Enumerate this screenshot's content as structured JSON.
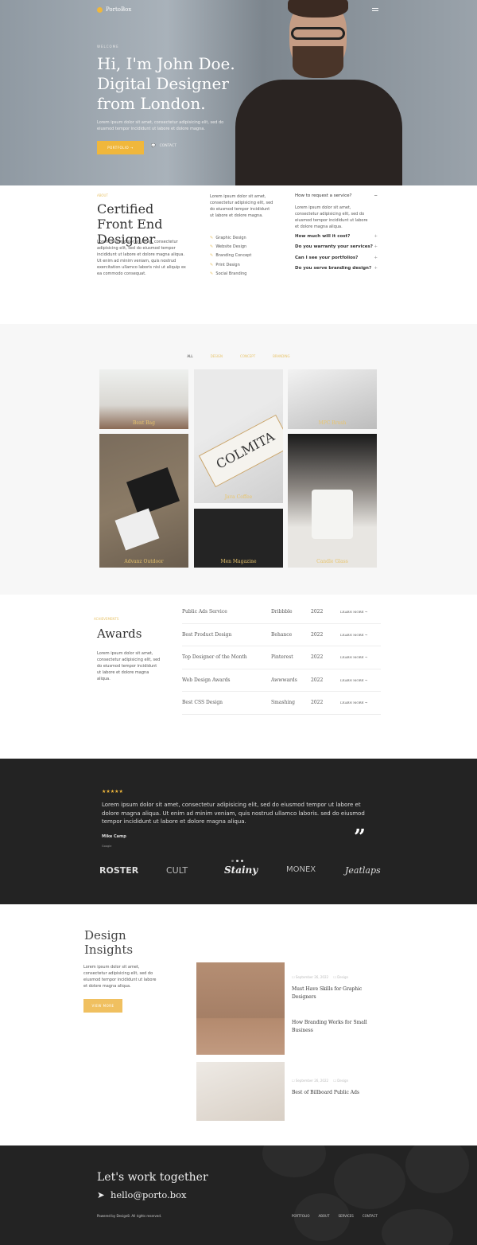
{
  "header": {
    "logo": "PortoBox",
    "menu_icon": "hamburger-icon"
  },
  "hero": {
    "eyebrow": "WELCOME",
    "title": "Hi, I'm John Doe. Digital Designer from London.",
    "text": "Lorem ipsum dolor sit amet, consectetur adipisicing elit, sed do eiusmod tempor incididunt ut labore et dolore magna.",
    "portfolio_btn": "PORTFOLIO →",
    "contact_btn": "CONTACT"
  },
  "about": {
    "eyebrow": "ABOUT",
    "title": "Certified Front End Designer",
    "text": "Lorem ipsum dolor sit amet, consectetur adipisicing elit, sed do eiusmod tempor incididunt ut labore et dolore magna aliqua. Ut enim ad minim veniam, quis nostrud exercitation ullamco laboris nisi ut aliquip ex ea commodo consequat.",
    "intro": "Lorem ipsum dolor sit amet, consectetur adipisicing elit, sed do eiusmod tempor incididunt ut labore et dolore magna.",
    "services": [
      "Graphic Design",
      "Website Design",
      "Branding Concept",
      "Print Design",
      "Social Branding"
    ],
    "faq_open": {
      "q": "How to request a service?",
      "a": "Lorem ipsum dolor sit amet, consectetur adipisicing elit, sed do eiusmod tempor incididunt ut labore et dolore magna aliqua."
    },
    "faqs": [
      "How much will it cost?",
      "Do you warranty your services?",
      "Can I see your portfolios?",
      "Do you serve branding design?"
    ]
  },
  "portfolio": {
    "filters": [
      "ALL",
      "DESIGN",
      "CONCEPT",
      "BRANDING"
    ],
    "items": [
      "Bent Bag",
      "Java Coffee",
      "MPC Brush",
      "Advanz Outdoor",
      "Men Magazine",
      "Candle Glass"
    ]
  },
  "awards": {
    "eyebrow": "ACHIEVEMENTS",
    "title": "Awards",
    "text": "Lorem ipsum dolor sit amet, consectetur adipisicing elit, sed do eiusmod tempor incididunt ut labore et dolore magna aliqua.",
    "rows": [
      {
        "name": "Public Ads Service",
        "site": "Dribbble",
        "year": "2022",
        "link": "LEARN MORE →"
      },
      {
        "name": "Best Product Design",
        "site": "Behance",
        "year": "2022",
        "link": "LEARN MORE →"
      },
      {
        "name": "Top Designer of the Month",
        "site": "Pinterest",
        "year": "2022",
        "link": "LEARN MORE →"
      },
      {
        "name": "Web Design Awards",
        "site": "Awwwards",
        "year": "2022",
        "link": "LEARN MORE →"
      },
      {
        "name": "Best CSS Design",
        "site": "Smashing",
        "year": "2022",
        "link": "LEARN MORE →"
      }
    ]
  },
  "testimonial": {
    "rating": 5,
    "stars": "★★★★★",
    "quote": "Lorem ipsum dolor sit amet, consectetur adipisicing elit, sed do eiusmod tempor ut labore et dolore magna aliqua. Ut enim ad minim veniam, quis nostrud ullamco laboris. sed do eiusmod tempor incididunt ut labore et dolore magna aliqua.",
    "author": "Mike Camp",
    "company": "Google",
    "brands": [
      "ROSTER",
      "CULT",
      "Stainy",
      "MONEX",
      "Jeatlaps"
    ]
  },
  "insights": {
    "title": "Design Insights",
    "text": "Lorem ipsum dolor sit amet, consectetur adipisicing elit, sed do eiusmod tempor incididunt ut labore et dolore magna aliqua.",
    "button": "VIEW MORE",
    "posts": [
      {
        "date": "September 26, 2022",
        "category": "Design",
        "title": "Must Have Skills for Graphic Designers"
      },
      {
        "title": "How Branding Works for Small Business"
      },
      {
        "date": "September 26, 2022",
        "category": "Design",
        "title": "Best of Billboard Public Ads"
      }
    ]
  },
  "footer": {
    "title": "Let's work together",
    "email": "hello@porto.box",
    "copyright": "Powered by Design8. All rights reserved.",
    "nav": [
      "PORTFOLIO",
      "ABOUT",
      "SERVICES",
      "CONTACT"
    ]
  },
  "colors": {
    "accent": "#f0b73c",
    "dark": "#232323"
  }
}
